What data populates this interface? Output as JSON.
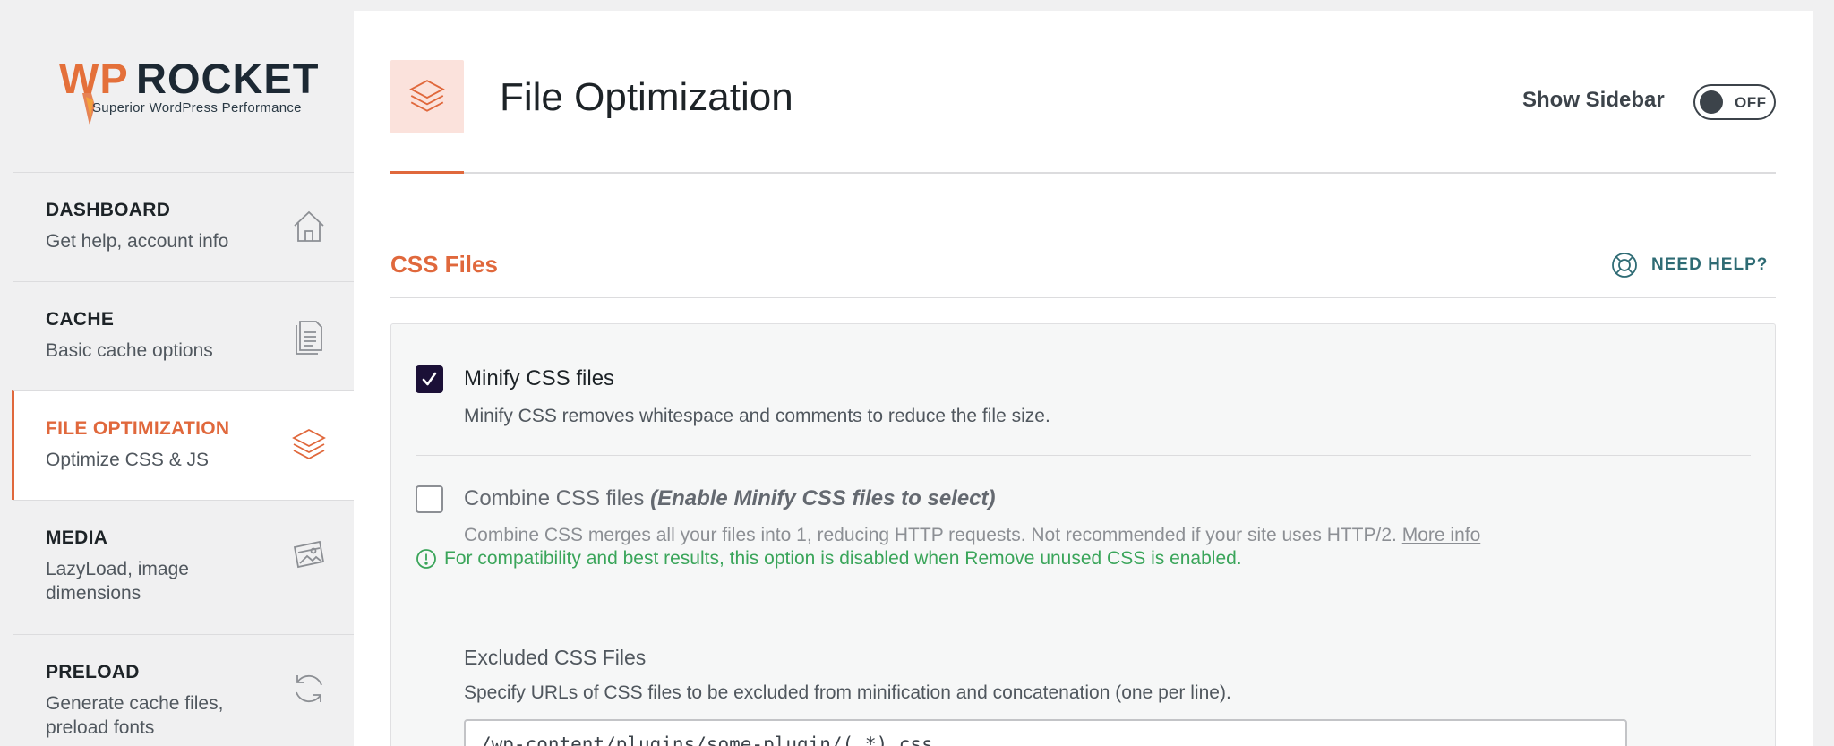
{
  "brand": {
    "logo_wp": "WP",
    "logo_name": "ROCKET",
    "tagline": "Superior WordPress Performance",
    "accent_color": "#e0683c"
  },
  "sidebar": {
    "items": [
      {
        "title": "DASHBOARD",
        "subtitle": "Get help, account info",
        "icon": "home-icon",
        "active": false
      },
      {
        "title": "CACHE",
        "subtitle": "Basic cache options",
        "icon": "document-icon",
        "active": false
      },
      {
        "title": "FILE OPTIMIZATION",
        "subtitle": "Optimize CSS & JS",
        "icon": "layers-icon",
        "active": true
      },
      {
        "title": "MEDIA",
        "subtitle": "LazyLoad, image dimensions",
        "icon": "images-icon",
        "active": false
      },
      {
        "title": "PRELOAD",
        "subtitle": "Generate cache files, preload fonts",
        "icon": "refresh-icon",
        "active": false
      }
    ]
  },
  "header": {
    "title": "File Optimization",
    "show_sidebar_label": "Show Sidebar",
    "toggle_state": "OFF"
  },
  "section": {
    "title": "CSS Files",
    "help_label": "NEED HELP?"
  },
  "options": {
    "minify": {
      "label": "Minify CSS files",
      "description": "Minify CSS removes whitespace and comments to reduce the file size.",
      "checked": true
    },
    "combine": {
      "label": "Combine CSS files",
      "label_note": "(Enable Minify CSS files to select)",
      "description": "Combine CSS merges all your files into 1, reducing HTTP requests. Not recommended if your site uses HTTP/2.",
      "more_info": "More info",
      "checked": false
    },
    "notice": "For compatibility and best results, this option is disabled when Remove unused CSS is enabled.",
    "excluded": {
      "title": "Excluded CSS Files",
      "description": "Specify URLs of CSS files to be excluded from minification and concatenation (one per line).",
      "value": "/wp-content/plugins/some-plugin/(.*).css"
    }
  }
}
